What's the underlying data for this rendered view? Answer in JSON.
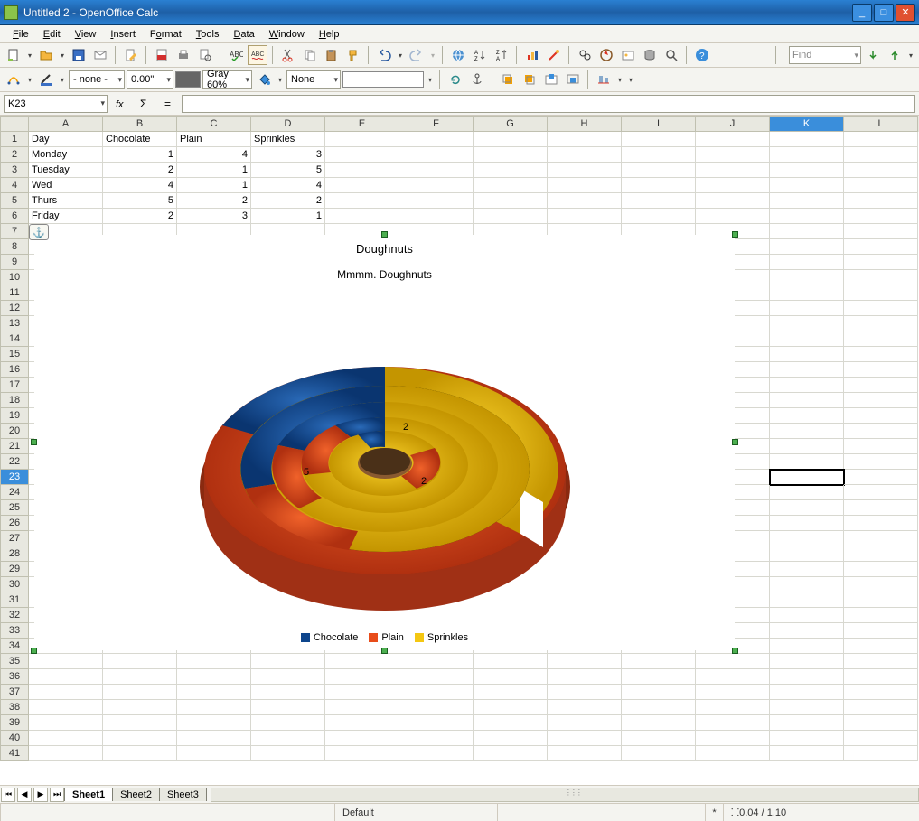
{
  "window": {
    "title": "Untitled 2 - OpenOffice Calc"
  },
  "menu": {
    "file": "File",
    "edit": "Edit",
    "view": "View",
    "insert": "Insert",
    "format": "Format",
    "tools": "Tools",
    "data": "Data",
    "window": "Window",
    "help": "Help"
  },
  "toolbar2": {
    "border_style": "- none -",
    "border_width": "0.00\"",
    "color_name": "Gray 60%",
    "arrow_style": "None"
  },
  "cellref": {
    "active": "K23",
    "formula": ""
  },
  "find": {
    "placeholder": "Find"
  },
  "columns": [
    "A",
    "B",
    "C",
    "D",
    "E",
    "F",
    "G",
    "H",
    "I",
    "J",
    "K",
    "L"
  ],
  "active_col_index": 10,
  "active_row": 23,
  "data_rows": [
    {
      "n": 1,
      "cells": [
        "Day",
        "Chocolate",
        "Plain",
        "Sprinkles"
      ]
    },
    {
      "n": 2,
      "cells": [
        "Monday",
        "1",
        "4",
        "3"
      ]
    },
    {
      "n": 3,
      "cells": [
        "Tuesday",
        "2",
        "1",
        "5"
      ]
    },
    {
      "n": 4,
      "cells": [
        "Wed",
        "4",
        "1",
        "4"
      ]
    },
    {
      "n": 5,
      "cells": [
        "Thurs",
        "5",
        "2",
        "2"
      ]
    },
    {
      "n": 6,
      "cells": [
        "Friday",
        "2",
        "3",
        "1"
      ]
    }
  ],
  "empty_rows": [
    7,
    8,
    9,
    10,
    11,
    12,
    13,
    14,
    15,
    16,
    17,
    18,
    19,
    20,
    21,
    22,
    23,
    24,
    25,
    26,
    27,
    28,
    29,
    30,
    31,
    32,
    33,
    34,
    35,
    36,
    37,
    38,
    39,
    40,
    41
  ],
  "chart": {
    "title": "Doughnuts",
    "subtitle": "Mmmm. Doughnuts",
    "legend": [
      "Chocolate",
      "Plain",
      "Sprinkles"
    ],
    "colors": {
      "Chocolate": "#0d458c",
      "Plain": "#e84c1a",
      "Sprinkles": "#f4c712"
    },
    "labels": {
      "inner1": "2",
      "inner2": "5",
      "inner3": "2"
    }
  },
  "chart_data": {
    "type": "pie",
    "subtype": "3d-doughnut-multi-ring",
    "title": "Doughnuts",
    "subtitle": "Mmmm. Doughnuts",
    "categories": [
      "Chocolate",
      "Plain",
      "Sprinkles"
    ],
    "series": [
      {
        "name": "Monday",
        "values": [
          1,
          4,
          3
        ]
      },
      {
        "name": "Tuesday",
        "values": [
          2,
          1,
          5
        ]
      },
      {
        "name": "Wed",
        "values": [
          4,
          1,
          4
        ]
      },
      {
        "name": "Thurs",
        "values": [
          5,
          2,
          2
        ]
      },
      {
        "name": "Friday",
        "values": [
          2,
          3,
          1
        ]
      }
    ],
    "colors": [
      "#0d458c",
      "#e84c1a",
      "#f4c712"
    ],
    "legend_position": "bottom"
  },
  "tabs": {
    "items": [
      "Sheet1",
      "Sheet2",
      "Sheet3"
    ],
    "active": 0
  },
  "status": {
    "style": "Default",
    "modified": "*",
    "coords": "0.04 / 1.10"
  }
}
